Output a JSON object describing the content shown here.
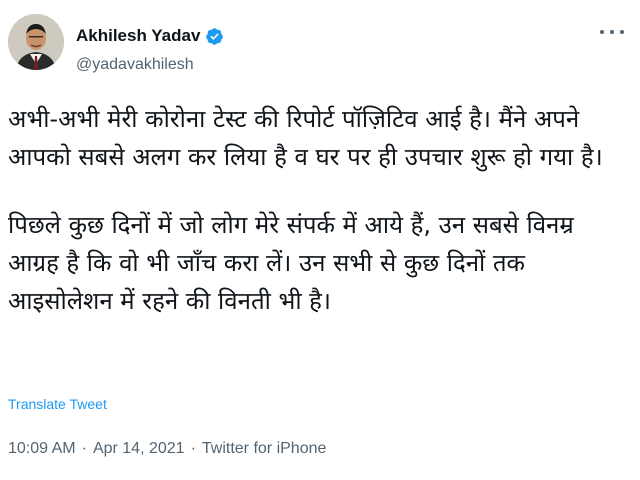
{
  "user": {
    "name": "Akhilesh Yadav",
    "handle": "@yadavakhilesh"
  },
  "tweet": {
    "paragraph_1": "अभी-अभी मेरी कोरोना टेस्ट की रिपोर्ट पॉज़िटिव आई है। मैंने अपने आपको सबसे अलग कर लिया है व घर पर ही उपचार शुरू हो गया है।",
    "paragraph_2": "पिछले कुछ दिनों में जो लोग मेरे संपर्क में आये हैं, उन सबसे विनम्र आग्रह है कि वो भी जाँच करा लें। उन सभी से कुछ दिनों तक आइसोलेशन में रहने की विनती भी है।",
    "translate_label": "Translate Tweet",
    "time": "10:09 AM",
    "date": "Apr 14, 2021",
    "source": "Twitter for iPhone",
    "separator": "·"
  },
  "colors": {
    "link": "#1d9bf0",
    "secondary_text": "#536471",
    "primary_text": "#0f1419"
  },
  "icons": {
    "verified": "verified-badge-icon",
    "more": "more-options-icon"
  }
}
